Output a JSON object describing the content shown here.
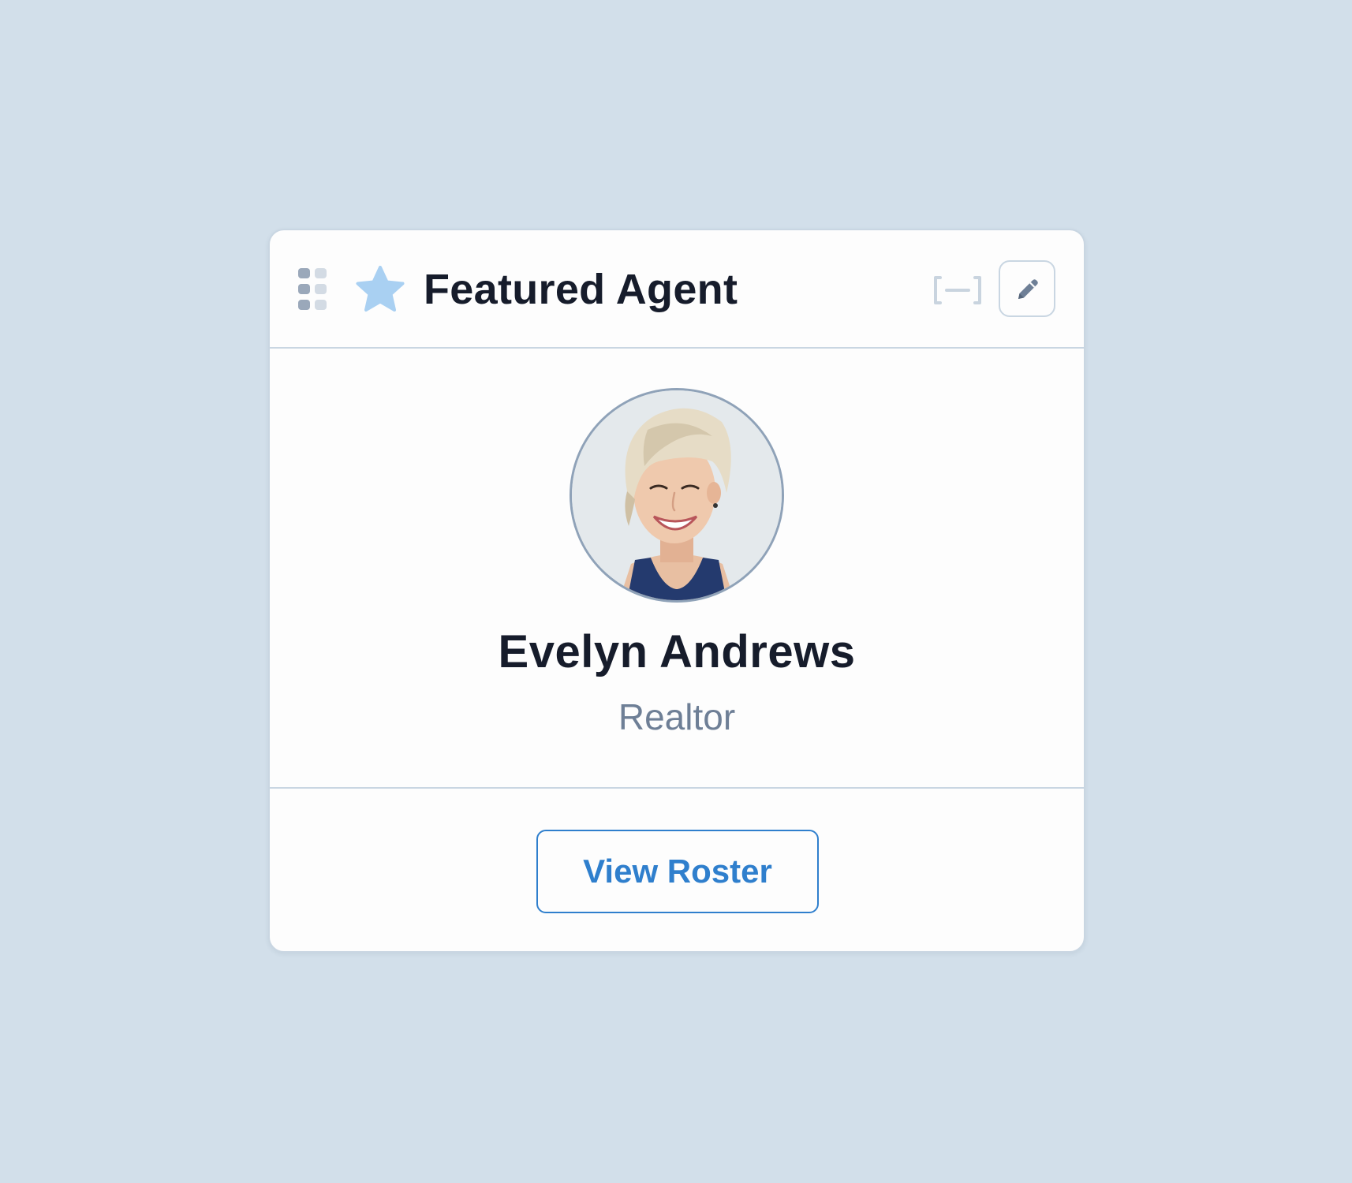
{
  "widget": {
    "title": "Featured Agent",
    "icons": {
      "drag": "drag-handle-icon",
      "star": "star-icon",
      "collapse": "collapse-icon",
      "edit": "pencil-icon"
    }
  },
  "agent": {
    "name": "Evelyn Andrews",
    "role": "Realtor",
    "avatar_alt": "Evelyn Andrews"
  },
  "footer": {
    "button_label": "View Roster"
  },
  "colors": {
    "background": "#d2dfea",
    "card": "#fdfdfd",
    "border": "#c9d6e2",
    "accent": "#2f7fcd",
    "star": "#a9d0f2",
    "title": "#161c2b",
    "muted": "#6e7f96"
  }
}
